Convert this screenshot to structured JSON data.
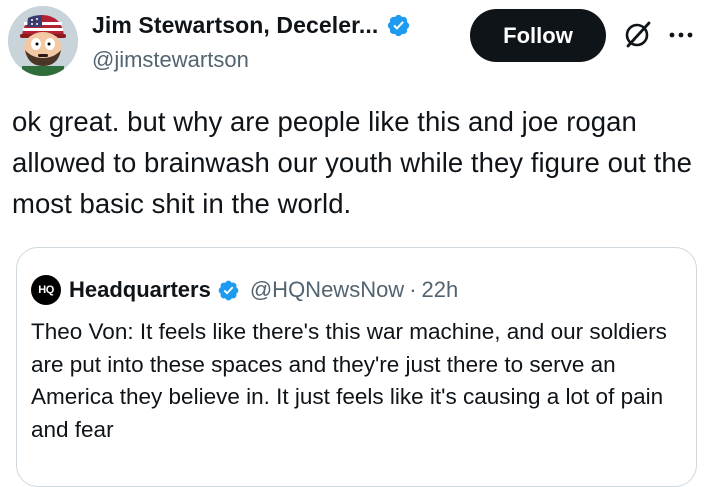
{
  "author": {
    "display_name": "Jim Stewartson, Deceler...",
    "handle": "@jimstewartson",
    "avatar_icon": "cartoon-avatar-icon",
    "verified_icon": "verified-badge-icon"
  },
  "actions": {
    "follow_label": "Follow",
    "grok_icon": "grok-icon",
    "more_icon": "more-options-icon"
  },
  "tweet": {
    "text": "ok great. but why are people like this and joe rogan allowed to brainwash our youth while they figure out the most basic shit in the world."
  },
  "quoted": {
    "logo_text": "HQ",
    "name": "Headquarters",
    "handle": "@HQNewsNow",
    "separator": "·",
    "time": "22h",
    "text": "Theo Von: It feels like there's this war machine, and our soldiers are put into these spaces and they're just there to serve an America they believe in. It just feels like it's causing a lot of pain and fear"
  },
  "colors": {
    "text_primary": "#0f1419",
    "text_secondary": "#536471",
    "verified_blue": "#1d9bf0",
    "border": "#cfd9de",
    "button_bg": "#0f1419"
  }
}
